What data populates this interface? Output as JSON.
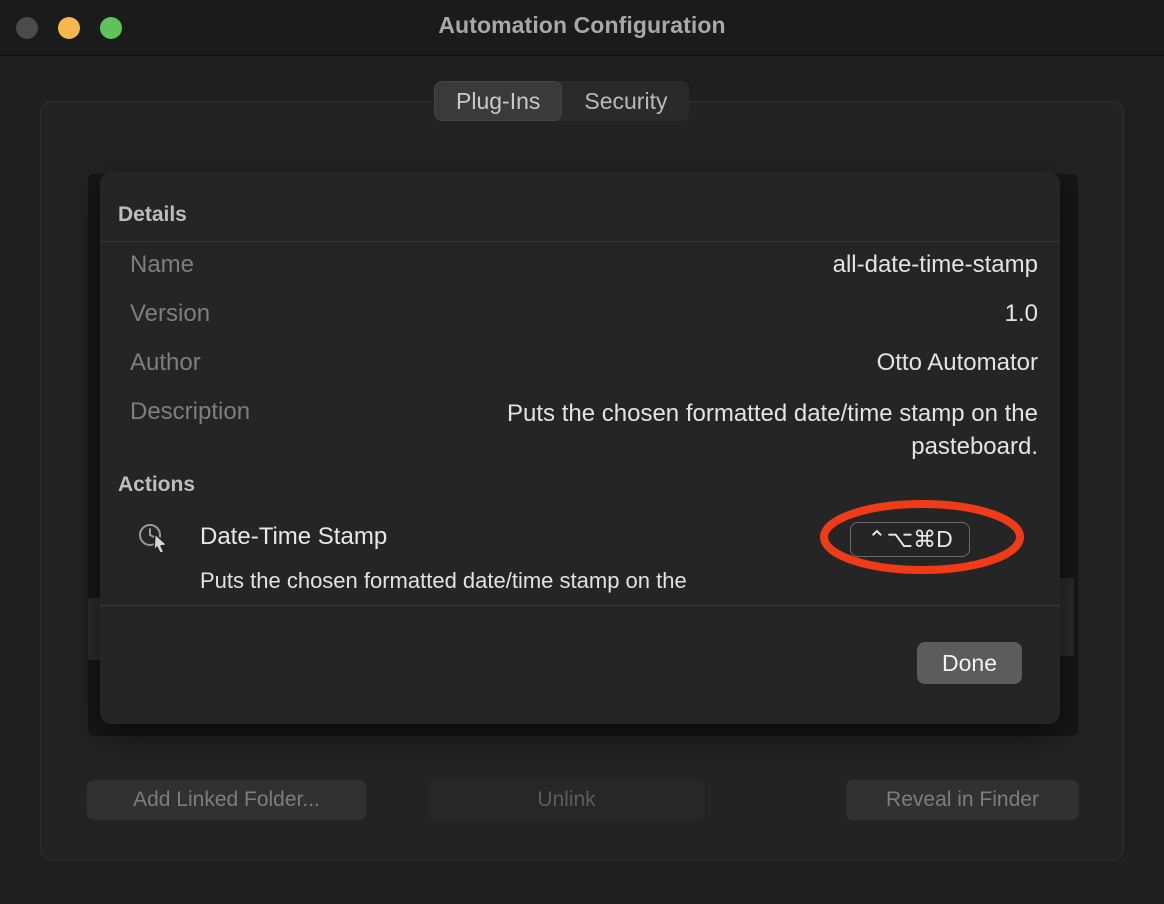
{
  "window": {
    "title": "Automation Configuration",
    "traffic_lights": [
      {
        "name": "close-button",
        "color": "#4b4b4b"
      },
      {
        "name": "minimize-button",
        "color": "#f5b84c"
      },
      {
        "name": "maximize-button",
        "color": "#5fc35a"
      }
    ]
  },
  "tabs": [
    {
      "label": "Plug-Ins",
      "active": true
    },
    {
      "label": "Security",
      "active": false
    }
  ],
  "sheet": {
    "header_title": "Details",
    "details": [
      {
        "label": "Name",
        "value": "all-date-time-stamp"
      },
      {
        "label": "Version",
        "value": "1.0"
      },
      {
        "label": "Author",
        "value": "Otto Automator"
      },
      {
        "label": "Description",
        "value": "Puts the chosen formatted date/time stamp on the pasteboard."
      }
    ],
    "actions_title": "Actions",
    "action": {
      "icon": "clock-cursor-icon",
      "name": "Date-Time Stamp",
      "description": "Puts the chosen formatted date/time stamp on the",
      "shortcut": "⌃⌥⌘D"
    },
    "done_label": "Done"
  },
  "bottom_buttons": [
    {
      "label": "Add Linked Folder...",
      "enabled": false
    },
    {
      "label": "Unlink",
      "enabled": false
    },
    {
      "label": "Reveal in Finder",
      "enabled": false
    }
  ],
  "annotation": {
    "shape": "ellipse",
    "color": "#ef3b18",
    "target": "keyboard-shortcut-badge"
  }
}
